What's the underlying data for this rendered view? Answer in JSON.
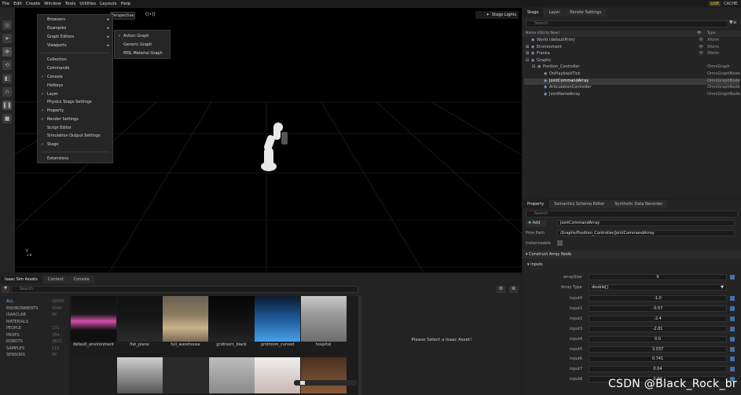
{
  "menubar": {
    "items": [
      "File",
      "Edit",
      "Create",
      "Window",
      "Tools",
      "Utilities",
      "Layouts",
      "Help"
    ],
    "live": "LIVE",
    "cache": "CACHE:"
  },
  "viewport": {
    "perspective_label": "Perspective",
    "stage_lights_label": "Stage Lights"
  },
  "window_menu": {
    "items": [
      {
        "label": "Browsers",
        "arrow": true,
        "checked": false
      },
      {
        "label": "Examples",
        "arrow": true,
        "checked": false
      },
      {
        "label": "Graph Editors",
        "arrow": true,
        "checked": false
      },
      {
        "label": "Viewports",
        "arrow": true,
        "checked": false
      },
      {
        "label": "Collection",
        "checked": false
      },
      {
        "label": "Commands",
        "checked": false
      },
      {
        "label": "Console",
        "checked": true
      },
      {
        "label": "Hotkeys",
        "checked": false
      },
      {
        "label": "Layer",
        "checked": true
      },
      {
        "label": "Physics Stage Settings",
        "checked": false
      },
      {
        "label": "Property",
        "checked": true
      },
      {
        "label": "Render Settings",
        "checked": true
      },
      {
        "label": "Script Editor",
        "checked": false
      },
      {
        "label": "Simulation Output Settings",
        "checked": false
      },
      {
        "label": "Stage",
        "checked": true
      },
      {
        "label": "Extensions",
        "checked": false
      }
    ]
  },
  "graph_submenu": {
    "items": [
      "Action Graph",
      "Generic Graph",
      "MDL Material Graph"
    ]
  },
  "stage": {
    "tabs": [
      "Stage",
      "Layer",
      "Render Settings"
    ],
    "search_placeholder": "Search",
    "col_name": "Name (Old to New)",
    "col_type": "Type",
    "rows": [
      {
        "label": "World (defaultPrim)",
        "type": "Xform"
      },
      {
        "label": "Environment",
        "type": "Xform"
      },
      {
        "label": "Franka",
        "type": "Xform"
      },
      {
        "label": "Graphs",
        "type": ""
      },
      {
        "label": "Position_Controller",
        "type": "OmniGraph"
      },
      {
        "label": "OnPlaybackTick",
        "type": "OmniGraphNode"
      },
      {
        "label": "JointCommandArray",
        "type": "OmniGraphNode"
      },
      {
        "label": "ArticulationController",
        "type": "OmniGraphNode"
      },
      {
        "label": "JointNameArray",
        "type": "OmniGraphNode"
      }
    ]
  },
  "property": {
    "tabs": [
      "Property",
      "Semantics Schema Editor",
      "Synthetic Data Recorder"
    ],
    "search_placeholder": "Search",
    "add_label": "Add",
    "name_value": "JointCommandArray",
    "prim_path_label": "Prim Path",
    "prim_path_value": "/Graphs/Position_Controller/JointCommandArray",
    "instanceable_label": "Instanceable",
    "section": "Construct Array Node",
    "inputs_label": "Inputs",
    "array_size_label": "arraySize",
    "array_size_value": "9",
    "array_type_label": "Array Type",
    "array_type_value": "double[]",
    "inputs": [
      {
        "label": "input0",
        "value": "-1.0"
      },
      {
        "label": "input1",
        "value": "-0.57"
      },
      {
        "label": "input2",
        "value": "-2.4"
      },
      {
        "label": "input3",
        "value": "-2.81"
      },
      {
        "label": "input4",
        "value": "0.0"
      },
      {
        "label": "input5",
        "value": "3.037"
      },
      {
        "label": "input6",
        "value": "0.741"
      },
      {
        "label": "input7",
        "value": "0.04"
      },
      {
        "label": "input8",
        "value": "0.04"
      }
    ]
  },
  "assets": {
    "tabs": [
      "Isaac Sim Assets",
      "Content",
      "Console"
    ],
    "search_placeholder": "Search",
    "categories": [
      {
        "label": "ALL",
        "count": "18695"
      },
      {
        "label": "ENVIRONMENTS",
        "count": "4346"
      },
      {
        "label": "ISAACLAB",
        "count": "96"
      },
      {
        "label": "MATERIALS",
        "count": ""
      },
      {
        "label": "PEOPLE",
        "count": "131"
      },
      {
        "label": "PROPS",
        "count": "384"
      },
      {
        "label": "ROBOTS",
        "count": "3823"
      },
      {
        "label": "SAMPLES",
        "count": "115"
      },
      {
        "label": "SENSORS",
        "count": "96"
      }
    ],
    "thumbnails": [
      "default_environment",
      "flat_plane",
      "full_warehouse",
      "gridroom_black",
      "gridroom_curved",
      "hospital"
    ],
    "empty_message": "Please Select a Isaac Asset!"
  },
  "watermark": "CSDN @Black_Rock_br",
  "colors": {
    "accent_check": "#8cc4ff",
    "selection": "#3b3b3b",
    "live_badge": "#e0d36a"
  }
}
